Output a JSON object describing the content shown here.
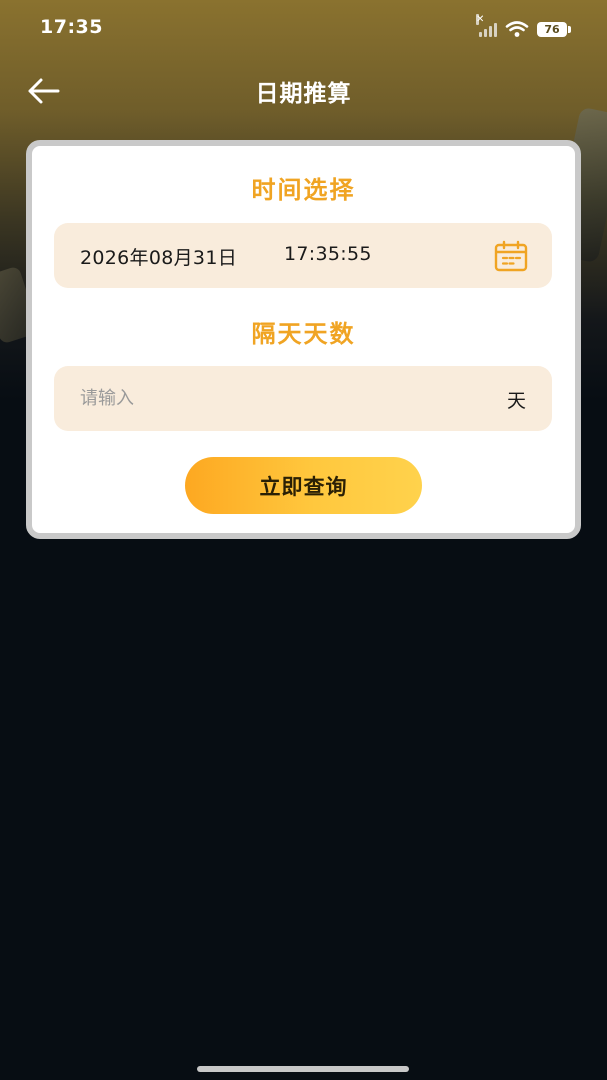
{
  "status_bar": {
    "time": "17:35",
    "battery": "76",
    "icons": [
      "signal-muted-icon",
      "wifi-icon",
      "battery-icon"
    ]
  },
  "nav": {
    "title": "日期推算",
    "back_icon": "arrow-left-icon"
  },
  "form": {
    "time_section_title": "时间选择",
    "date_value": "2026年08月31日",
    "time_value": "17:35:55",
    "calendar_icon": "calendar-icon",
    "days_section_title": "隔天天数",
    "days_placeholder": "请输入",
    "days_value": "",
    "days_unit": "天",
    "query_button_label": "立即查询"
  },
  "colors": {
    "accent": "#f0a423",
    "field_bg": "#f9ecdc",
    "button_start": "#fda821",
    "button_end": "#ffd24c",
    "header_gold": "#8a722f",
    "page_bg": "#070d13"
  }
}
